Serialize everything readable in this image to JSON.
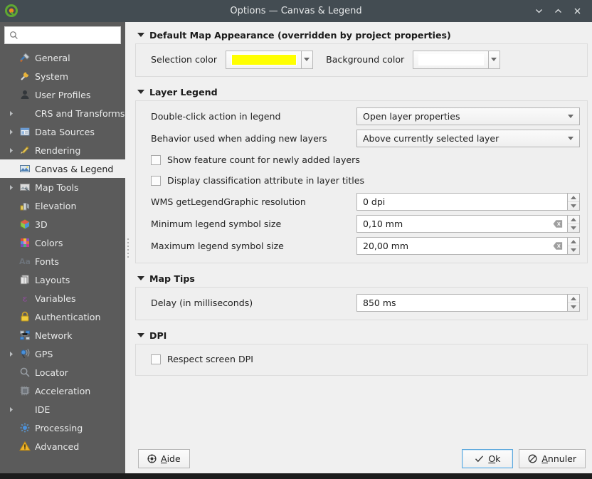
{
  "window": {
    "title": "Options — Canvas & Legend",
    "logo_icon": "qgis-logo-icon",
    "controls": [
      {
        "name": "minimize-button",
        "icon": "chevron-down-icon"
      },
      {
        "name": "maximize-button",
        "icon": "chevron-up-icon"
      },
      {
        "name": "close-button",
        "icon": "close-icon"
      }
    ]
  },
  "sidebar": {
    "search": {
      "value": "",
      "placeholder": "",
      "icon": "search-icon"
    },
    "items": [
      {
        "label": "General",
        "icon": "general-icon",
        "expandable": false,
        "selected": false
      },
      {
        "label": "System",
        "icon": "system-icon",
        "expandable": false,
        "selected": false
      },
      {
        "label": "User Profiles",
        "icon": "user-profiles-icon",
        "expandable": false,
        "selected": false
      },
      {
        "label": "CRS and Transforms",
        "icon": "",
        "expandable": true,
        "selected": false
      },
      {
        "label": "Data Sources",
        "icon": "data-sources-icon",
        "expandable": true,
        "selected": false
      },
      {
        "label": "Rendering",
        "icon": "rendering-icon",
        "expandable": true,
        "selected": false
      },
      {
        "label": "Canvas & Legend",
        "icon": "canvas-legend-icon",
        "expandable": false,
        "selected": true
      },
      {
        "label": "Map Tools",
        "icon": "map-tools-icon",
        "expandable": true,
        "selected": false
      },
      {
        "label": "Elevation",
        "icon": "elevation-icon",
        "expandable": false,
        "selected": false
      },
      {
        "label": "3D",
        "icon": "three-d-icon",
        "expandable": false,
        "selected": false
      },
      {
        "label": "Colors",
        "icon": "colors-icon",
        "expandable": false,
        "selected": false
      },
      {
        "label": "Fonts",
        "icon": "fonts-icon",
        "expandable": false,
        "selected": false
      },
      {
        "label": "Layouts",
        "icon": "layouts-icon",
        "expandable": false,
        "selected": false
      },
      {
        "label": "Variables",
        "icon": "variables-icon",
        "expandable": false,
        "selected": false
      },
      {
        "label": "Authentication",
        "icon": "authentication-icon",
        "expandable": false,
        "selected": false
      },
      {
        "label": "Network",
        "icon": "network-icon",
        "expandable": false,
        "selected": false
      },
      {
        "label": "GPS",
        "icon": "gps-icon",
        "expandable": true,
        "selected": false
      },
      {
        "label": "Locator",
        "icon": "locator-icon",
        "expandable": false,
        "selected": false
      },
      {
        "label": "Acceleration",
        "icon": "acceleration-icon",
        "expandable": false,
        "selected": false
      },
      {
        "label": "IDE",
        "icon": "",
        "expandable": true,
        "selected": false
      },
      {
        "label": "Processing",
        "icon": "processing-icon",
        "expandable": false,
        "selected": false
      },
      {
        "label": "Advanced",
        "icon": "advanced-icon",
        "expandable": false,
        "selected": false
      }
    ]
  },
  "main": {
    "groups": {
      "appearance": {
        "title": "Default Map Appearance (overridden by project properties)",
        "selection_color_label": "Selection color",
        "selection_color_value": "#ffff00",
        "background_color_label": "Background color",
        "background_color_value": "#ffffff"
      },
      "layer_legend": {
        "title": "Layer Legend",
        "double_click_label": "Double-click action in legend",
        "double_click_value": "Open layer properties",
        "behavior_label": "Behavior used when adding new layers",
        "behavior_value": "Above currently selected layer",
        "show_feature_count_label": "Show feature count for newly added layers",
        "show_feature_count_checked": false,
        "display_classification_label": "Display classification attribute in layer titles",
        "display_classification_checked": false,
        "wms_label": "WMS getLegendGraphic resolution",
        "wms_value": "0 dpi",
        "min_symbol_label": "Minimum legend symbol size",
        "min_symbol_value": "0,10 mm",
        "max_symbol_label": "Maximum legend symbol size",
        "max_symbol_value": "20,00 mm"
      },
      "map_tips": {
        "title": "Map Tips",
        "delay_label": "Delay (in milliseconds)",
        "delay_value": "850 ms"
      },
      "dpi": {
        "title": "DPI",
        "respect_label": "Respect screen DPI",
        "respect_checked": false
      }
    }
  },
  "footer": {
    "help_label": "Aide",
    "help_accel": "A",
    "ok_label": "Ok",
    "ok_accel": "O",
    "cancel_label": "Annuler",
    "cancel_accel": "A"
  }
}
